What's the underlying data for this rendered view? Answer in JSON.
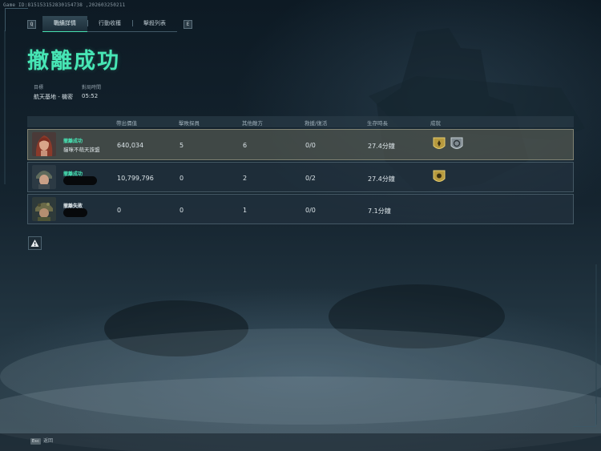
{
  "watermark": "Game ID:815153152830154738 ,202603250211",
  "tabs": {
    "left_key": "Q",
    "right_key": "E",
    "items": [
      {
        "label": "戰績詳情",
        "active": true
      },
      {
        "label": "行動收穫",
        "active": false
      },
      {
        "label": "擊殺列表",
        "active": false
      }
    ]
  },
  "page_title": "撤離成功",
  "info": {
    "target_label": "目標",
    "target_value": "航天基地 - 機密",
    "time_label": "對局時間",
    "time_value": "05:52"
  },
  "table": {
    "headers": {
      "value": "帶出價值",
      "kills_op": "擊敗探員",
      "other_kills": "其他敵方",
      "rescue": "救援/復活",
      "survival": "生存時長",
      "achievements": "成就"
    },
    "rows": [
      {
        "status": "撤離成功",
        "name": "貓咪不萌天誅盟",
        "value": "640,034",
        "kills_op": "5",
        "other_kills": "6",
        "rescue": "0/0",
        "survival": "27.4分鐘",
        "achievements": [
          "gold-shield-badge-icon",
          "silver-emblem-badge-icon"
        ]
      },
      {
        "status": "撤離成功",
        "name": "",
        "value": "10,799,796",
        "kills_op": "0",
        "other_kills": "2",
        "rescue": "0/2",
        "survival": "27.4分鐘",
        "achievements": [
          "gold-shield-badge-icon"
        ]
      },
      {
        "status": "撤離失敗",
        "name": "",
        "value": "0",
        "kills_op": "0",
        "other_kills": "1",
        "rescue": "0/0",
        "survival": "7.1分鐘",
        "achievements": []
      }
    ]
  },
  "footer": {
    "key": "Esc",
    "label": "返回"
  },
  "colors": {
    "accent": "#47e6b5",
    "title": "#47e6b5"
  }
}
